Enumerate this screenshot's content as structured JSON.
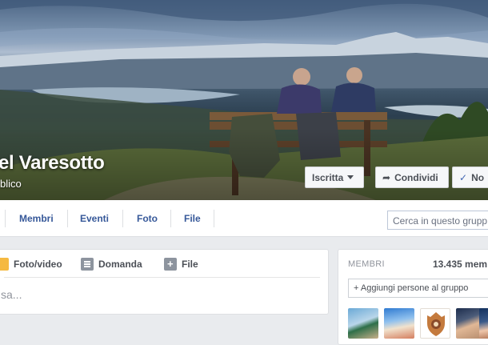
{
  "group": {
    "title": "el Varesotto",
    "privacy": "blico"
  },
  "cover_buttons": {
    "joined_label": "Iscritta",
    "share_label": "Condividi",
    "notifications_label": "No"
  },
  "nav": {
    "items": [
      "Membri",
      "Eventi",
      "Foto",
      "File"
    ],
    "search_placeholder": "Cerca in questo grupp"
  },
  "composer": {
    "actions": [
      "Foto/video",
      "Domanda",
      "File"
    ],
    "placeholder": "sa..."
  },
  "members": {
    "label": "MEMBRI",
    "count": "13.435 mem",
    "add_placeholder": "+ Aggiungi persone al gruppo"
  },
  "colors": {
    "link_blue": "#365899",
    "page_bg": "#e9ebee",
    "photo_icon": "#f5b941"
  }
}
